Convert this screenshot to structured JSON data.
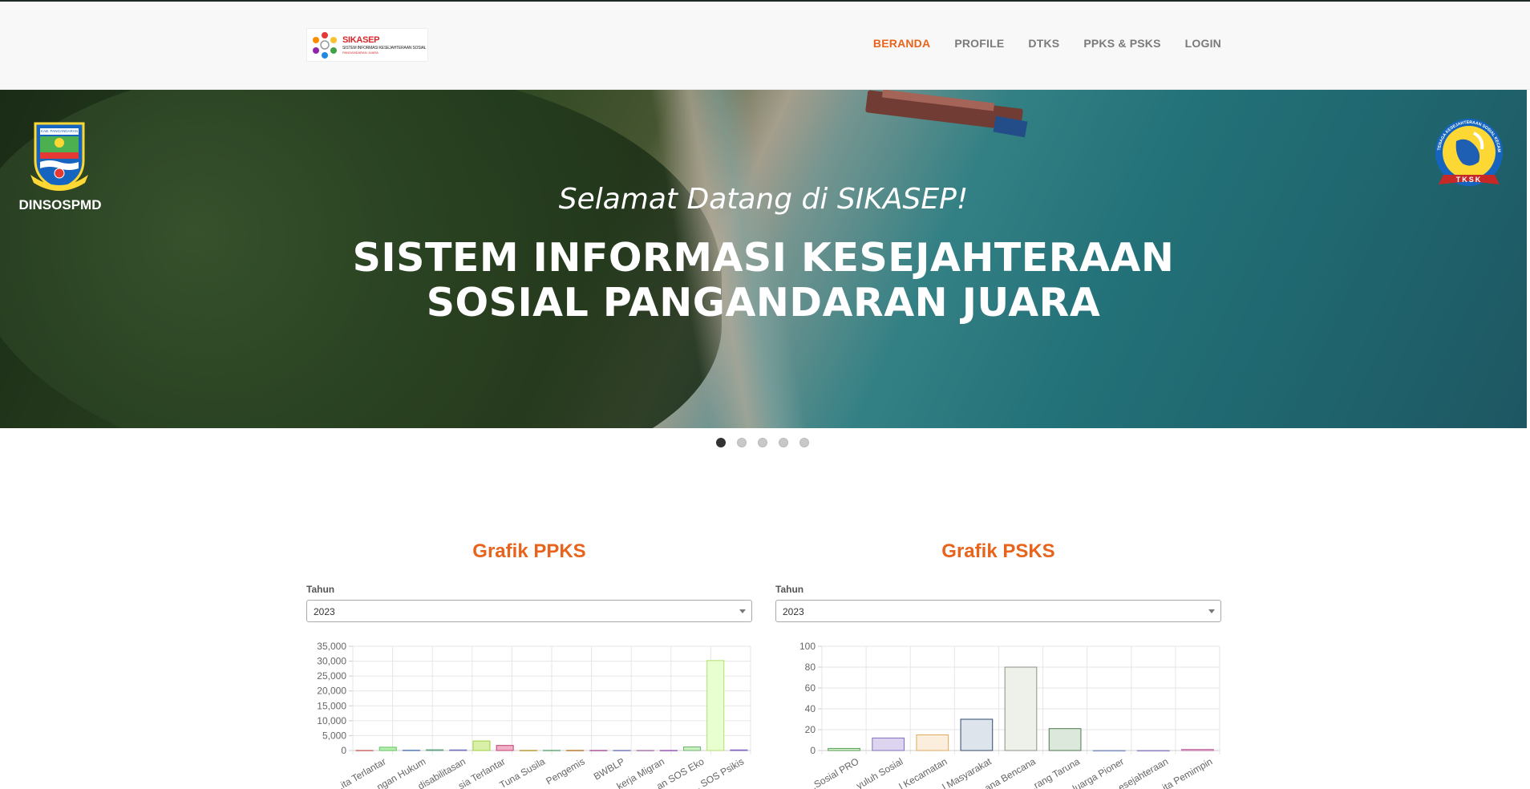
{
  "header": {
    "brand": {
      "name": "SIKASEP",
      "subtitle": "SISTEM INFORMASI KESEJAHTERAAN SOSIAL",
      "tagline": "PANGANDARAN JUARA"
    },
    "menu": [
      {
        "label": "BERANDA",
        "active": true
      },
      {
        "label": "PROFILE",
        "active": false
      },
      {
        "label": "DTKS",
        "active": false
      },
      {
        "label": "PPKS & PSKS",
        "active": false
      },
      {
        "label": "LOGIN",
        "active": false
      }
    ]
  },
  "hero": {
    "left_emblem_label": "DINSOSPMD",
    "left_emblem_text": "KAB. PANGANDARAN",
    "right_emblem_text": "TENAGA KESEJAHTERAAN SOSIAL KECAMATAN",
    "right_emblem_ribbon": "TKSK",
    "welcome": "Selamat Datang di SIKASEP!",
    "title_line1": "SISTEM INFORMASI KESEJAHTERAAN",
    "title_line2": "SOSIAL PANGANDARAN JUARA",
    "slides": 5,
    "active_slide": 1
  },
  "colors": {
    "accent": "#e8641c",
    "nav_text": "#7a7a7a"
  },
  "ppks": {
    "heading": "Grafik PPKS",
    "year_label": "Tahun",
    "year_value": "2023"
  },
  "psks": {
    "heading": "Grafik PSKS",
    "year_label": "Tahun",
    "year_value": "2023"
  },
  "chart_data": [
    {
      "type": "bar",
      "title": "Grafik PPKS",
      "categories": [
        "...ita Terlantar",
        "...ngan Hukum",
        "...disabilitasan",
        "...sia Terlantar",
        "Tuna Susila",
        "Pengemis",
        "BWBLP",
        "...kerja Migran",
        "...an SOS Eko",
        "... SOS Psikis"
      ],
      "values": [
        60,
        1100,
        120,
        250,
        200,
        3200,
        1700,
        60,
        80,
        70,
        60,
        60,
        50,
        50,
        1200,
        30200,
        200
      ],
      "bar_colors": [
        "#f2b0b0",
        "#b6f0b0",
        "#a8c8f0",
        "#b0e0c8",
        "#c0c0f0",
        "#d8f0a8",
        "#f0b0c8",
        "#f0e0a0",
        "#c8f0d0",
        "#f0c8a8",
        "#e8b0e0",
        "#d0d0f0",
        "#f0d0f0",
        "#e0b0f0",
        "#c8f0c0",
        "#e8ffd0",
        "#d0b0f0"
      ],
      "bar_borders": [
        "#d07070",
        "#60c060",
        "#6080c0",
        "#60a080",
        "#7070c0",
        "#a0d040",
        "#c04070",
        "#c0a040",
        "#70b080",
        "#c08040",
        "#b060a0",
        "#8080c0",
        "#b080b0",
        "#a060c0",
        "#70b070",
        "#b0e070",
        "#8060c0"
      ],
      "yticks": [
        0,
        5000,
        10000,
        15000,
        20000,
        25000,
        30000,
        35000
      ],
      "ytick_labels": [
        "0",
        "5,000",
        "10,000",
        "15,000",
        "20,000",
        "25,000",
        "30,000",
        "35,000"
      ],
      "ylim": [
        0,
        35000
      ],
      "grid": true,
      "legend": false
    },
    {
      "type": "bar",
      "title": "Grafik PSKS",
      "categories": [
        "...Sosial PRO",
        "...yuluh Sosial",
        "...l Kecamatan",
        "...l Masyarakat",
        "...ana Bencana",
        "...rang Taruna",
        "...luarga Pioner",
        "...esejahteraan",
        "...ita Pemimpin"
      ],
      "values": [
        2,
        12,
        15,
        30,
        80,
        21,
        0,
        0,
        1
      ],
      "bar_colors": [
        "#d8f0d0",
        "#ddd4f0",
        "#fbeedc",
        "#dde4ec",
        "#eef0ea",
        "#dde8dc",
        "#e8f0ff",
        "#f0e8ff",
        "#f8e0f0"
      ],
      "bar_borders": [
        "#50a050",
        "#8070c0",
        "#e0a860",
        "#2f4a6a",
        "#8a9080",
        "#4a7a4a",
        "#8090c0",
        "#9080c0",
        "#c060a0"
      ],
      "yticks": [
        0,
        20,
        40,
        60,
        80,
        100
      ],
      "ytick_labels": [
        "0",
        "20",
        "40",
        "60",
        "80",
        "100"
      ],
      "ylim": [
        0,
        100
      ],
      "grid": true,
      "legend": false
    }
  ]
}
